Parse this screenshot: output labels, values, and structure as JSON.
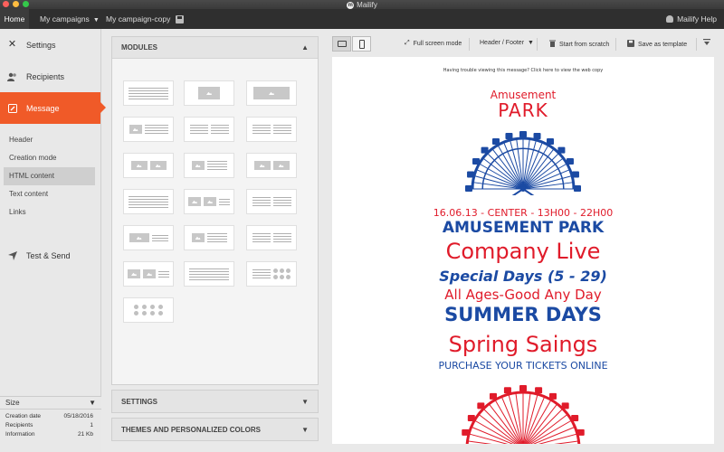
{
  "window": {
    "title": "Mailify"
  },
  "topbar": {
    "home": "Home",
    "campaigns": "My campaigns",
    "campaign_copy": "My campaign-copy",
    "help": "Mailify Help"
  },
  "sidebar": {
    "items": [
      {
        "label": "Settings",
        "icon": "tools-icon"
      },
      {
        "label": "Recipients",
        "icon": "users-icon"
      },
      {
        "label": "Message",
        "icon": "edit-icon"
      }
    ],
    "subitems": [
      "Header",
      "Creation mode",
      "HTML content",
      "Text content",
      "Links"
    ],
    "test_send": "Test & Send",
    "size": {
      "title": "Size",
      "rows": [
        {
          "label": "Creation date",
          "value": "05/18/2016"
        },
        {
          "label": "Recipients",
          "value": "1"
        },
        {
          "label": "Information",
          "value": "21 Kb"
        }
      ]
    }
  },
  "modules": {
    "title": "MODULES"
  },
  "panels": {
    "settings": "SETTINGS",
    "themes": "THEMES AND PERSONALIZED COLORS"
  },
  "toolbar": {
    "fullscreen": "Full screen mode",
    "header_footer": "Header / Footer",
    "start_scratch": "Start from scratch",
    "save_template": "Save as template"
  },
  "email": {
    "trouble": "Having trouble viewing this message? Click here to view the web copy",
    "ap_line1": "Amusement",
    "ap_line2": "PARK",
    "line1": "16.06.13 - CENTER - 13H00 - 22H00",
    "line2": "AMUSEMENT PARK",
    "line3": "Company Live",
    "line4": "Special Days (5 - 29)",
    "line5": "All Ages-Good Any Day",
    "line6": "SUMMER DAYS",
    "line7": "Spring Saings",
    "line8": "PURCHASE YOUR TICKETS ONLINE"
  },
  "colors": {
    "accent": "#f05a28",
    "red": "#e01b2a",
    "blue": "#1b4aa3"
  }
}
